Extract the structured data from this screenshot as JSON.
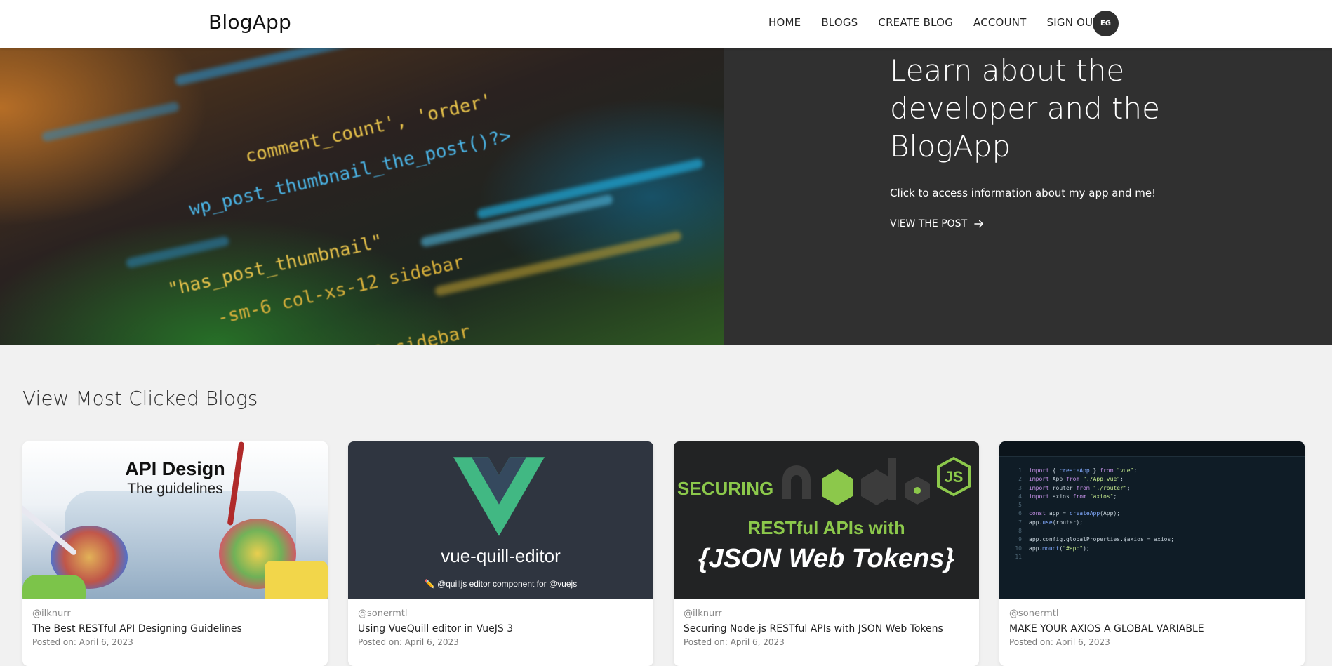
{
  "nav": {
    "brand": "BlogApp",
    "links": [
      "HOME",
      "BLOGS",
      "CREATE BLOG",
      "ACCOUNT",
      "SIGN OUT"
    ],
    "avatar_initials": "EG"
  },
  "hero": {
    "title": "Learn about the developer and the BlogApp",
    "subtitle": "Click to access information about my app and me!",
    "link_label": "VIEW THE POST"
  },
  "section": {
    "title": "View Most Clicked Blogs"
  },
  "cards": [
    {
      "image_text_1": "API Design",
      "image_text_2": "The guidelines",
      "author": "@ilknurr",
      "title": "The Best RESTful API Designing Guidelines",
      "date": "Posted on: April 6, 2023"
    },
    {
      "image_text_1": "vue-quill-editor",
      "image_text_2": "✏️ @quilljs editor component for @vuejs",
      "author": "@sonermtl",
      "title": "Using VueQuill editor in VueJS 3",
      "date": "Posted on: April 6, 2023"
    },
    {
      "image_text_1": "SECURING",
      "image_text_2": "RESTful APIs with",
      "image_text_3": "{JSON Web Tokens}",
      "author": "@ilknurr",
      "title": "Securing Node.js RESTful APIs with JSON Web Tokens",
      "date": "Posted on: April 6, 2023"
    },
    {
      "author": "@sonermtl",
      "title": "MAKE YOUR AXIOS A GLOBAL VARIABLE",
      "date": "Posted on: April 6, 2023"
    }
  ],
  "colors": {
    "nav_bg": "#ffffff",
    "hero_bg": "#303030",
    "page_bg": "#f1f1f1",
    "node_green": "#8cc84b",
    "vue_green": "#41b883",
    "vue_dark": "#35495e"
  },
  "icons": {
    "hero_link": "arrow-right-icon"
  }
}
